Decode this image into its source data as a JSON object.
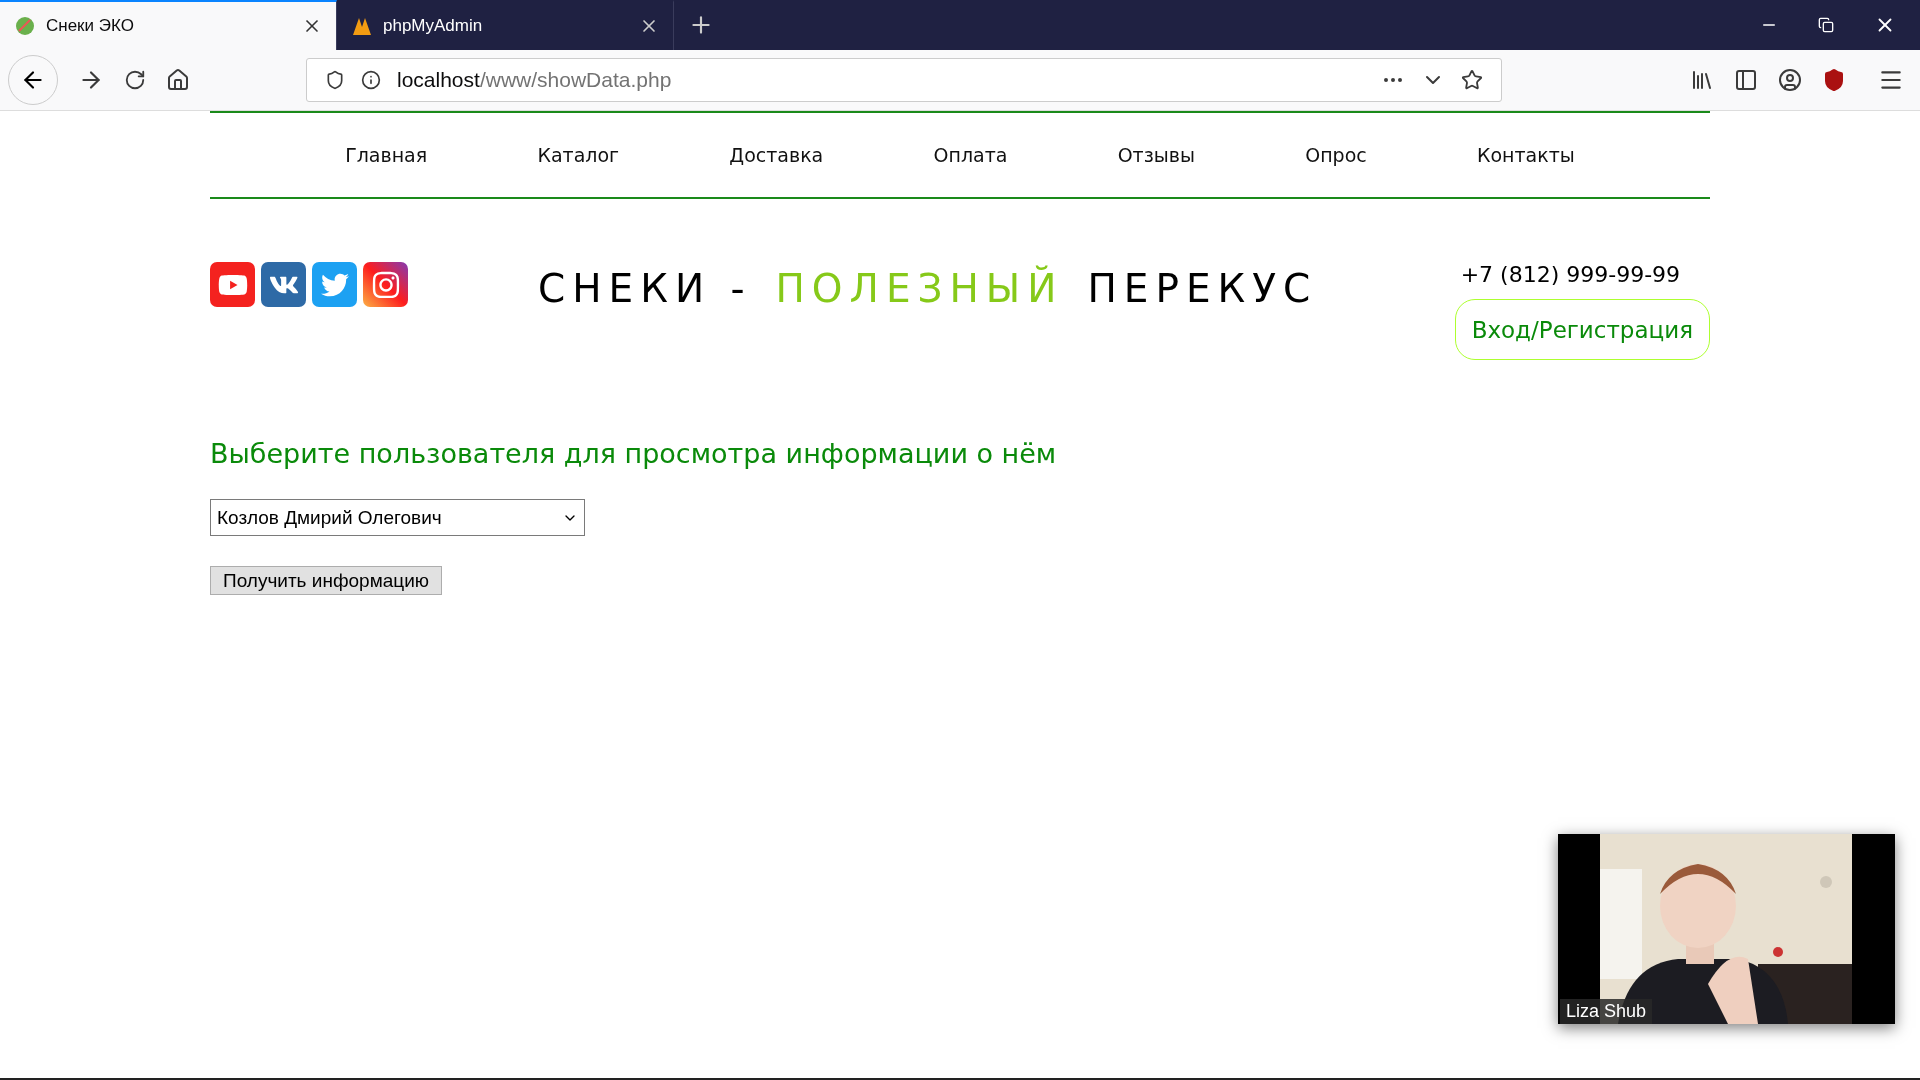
{
  "browser": {
    "tabs": [
      {
        "title": "Снеки ЭКО",
        "selected": true
      },
      {
        "title": "phpMyAdmin",
        "selected": false
      }
    ],
    "url": {
      "host": "localhost",
      "path": "/www/showData.php"
    }
  },
  "nav": [
    "Главная",
    "Каталог",
    "Доставка",
    "Оплата",
    "Отзывы",
    "Опрос",
    "Контакты"
  ],
  "header": {
    "title_parts": [
      {
        "text": "СНЕКИ -",
        "highlighted": false
      },
      {
        "text": "ПОЛЕЗНЫЙ",
        "highlighted": true
      },
      {
        "text": "ПЕРЕКУС",
        "highlighted": false
      }
    ],
    "phone": "+7 (812) 999-99-99",
    "login_button": "Вход/Регистрация"
  },
  "form": {
    "heading": "Выберите пользователя для просмотра информации о нём",
    "select_value": "Козлов Дмирий Олегович",
    "submit": "Получить информацию"
  },
  "video_call": {
    "participant": "Liza Shub"
  }
}
